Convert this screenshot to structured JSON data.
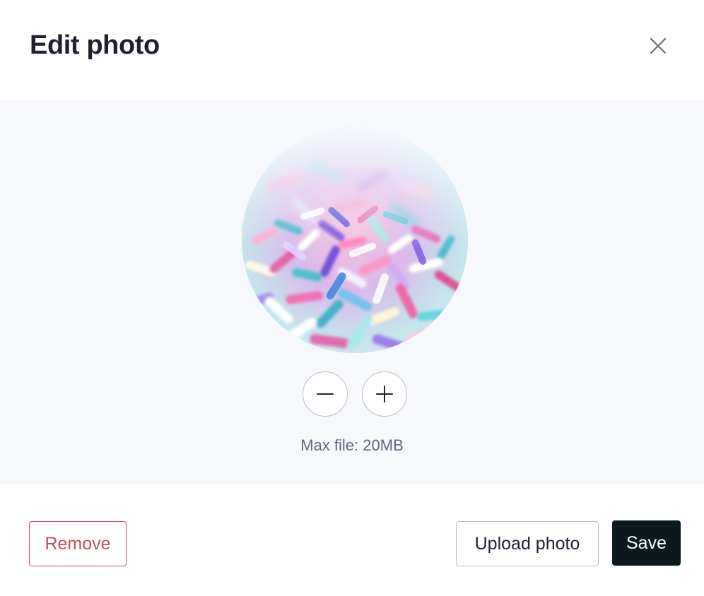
{
  "dialog": {
    "title": "Edit photo",
    "close_icon": "close-icon"
  },
  "editor": {
    "preview_alt": "Colorful sprinkles",
    "zoom_out_icon": "minus-icon",
    "zoom_in_icon": "plus-icon",
    "max_file_text": "Max file: 20MB"
  },
  "footer": {
    "remove_label": "Remove",
    "upload_label": "Upload photo",
    "save_label": "Save"
  },
  "colors": {
    "title_text": "#1f2130",
    "editor_background": "#f7f8fc",
    "remove_text": "#c14d58",
    "save_background": "#0d191c"
  }
}
